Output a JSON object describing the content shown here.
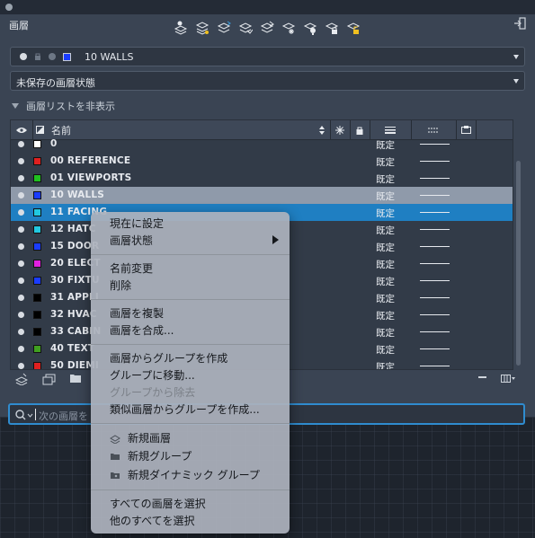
{
  "palette": {
    "title": "画層",
    "current_layer": {
      "name": "10 WALLS",
      "swatch_color": "#1a3cff"
    },
    "layer_state": "未保存の画層状態",
    "hide_list_label": "画層リストを非表示"
  },
  "toolbar_icons": [
    "new-layer-icon",
    "new-vp-frozen-layer-icon",
    "layer-merge-icon",
    "layer-isolate-icon",
    "layer-off-icon",
    "layer-freeze-icon",
    "layer-lock-icon",
    "layer-lock2-icon",
    "layer-unlock-icon"
  ],
  "columns": {
    "name": "名前"
  },
  "rows": [
    {
      "name": "0",
      "color": "#ffffff",
      "plot": "既定",
      "state": "normal"
    },
    {
      "name": "00 REFERENCE",
      "color": "#e02020",
      "plot": "既定",
      "state": "normal"
    },
    {
      "name": "01 VIEWPORTS",
      "color": "#20c020",
      "plot": "既定",
      "state": "normal"
    },
    {
      "name": "10 WALLS",
      "color": "#1a3cff",
      "plot": "既定",
      "state": "current"
    },
    {
      "name": "11 FACING",
      "color": "#22c8e0",
      "plot": "既定",
      "state": "selected"
    },
    {
      "name": "12 HATC",
      "color": "#22c8e0",
      "plot": "既定",
      "state": "normal"
    },
    {
      "name": "15 DOOR",
      "color": "#1a3cff",
      "plot": "既定",
      "state": "normal"
    },
    {
      "name": "20 ELECT",
      "color": "#e020e0",
      "plot": "既定",
      "state": "normal"
    },
    {
      "name": "30 FIXTU",
      "color": "#1a3cff",
      "plot": "既定",
      "state": "normal"
    },
    {
      "name": "31 APPLI",
      "color": "#000000",
      "plot": "既定",
      "state": "normal"
    },
    {
      "name": "32 HVAC",
      "color": "#000000",
      "plot": "既定",
      "state": "normal"
    },
    {
      "name": "33 CABIN",
      "color": "#000000",
      "plot": "既定",
      "state": "normal"
    },
    {
      "name": "40 TEXT",
      "color": "#40a020",
      "plot": "既定",
      "state": "normal"
    },
    {
      "name": "50 DIEMI",
      "color": "#e02020",
      "plot": "既定",
      "state": "normal"
    }
  ],
  "search": {
    "placeholder": "次の画層を"
  },
  "context_menu": {
    "set_current": "現在に設定",
    "layer_state": "画層状態",
    "rename": "名前変更",
    "delete": "削除",
    "duplicate": "画層を複製",
    "merge": "画層を合成...",
    "group_from_layers": "画層からグループを作成",
    "move_to_group": "グループに移動...",
    "remove_from_group": "グループから除去",
    "group_from_similar": "類似画層からグループを作成...",
    "new_layer": "新規画層",
    "new_group": "新規グループ",
    "new_dynamic_group": "新規ダイナミック グループ",
    "select_all": "すべての画層を選択",
    "select_others": "他のすべてを選択"
  }
}
